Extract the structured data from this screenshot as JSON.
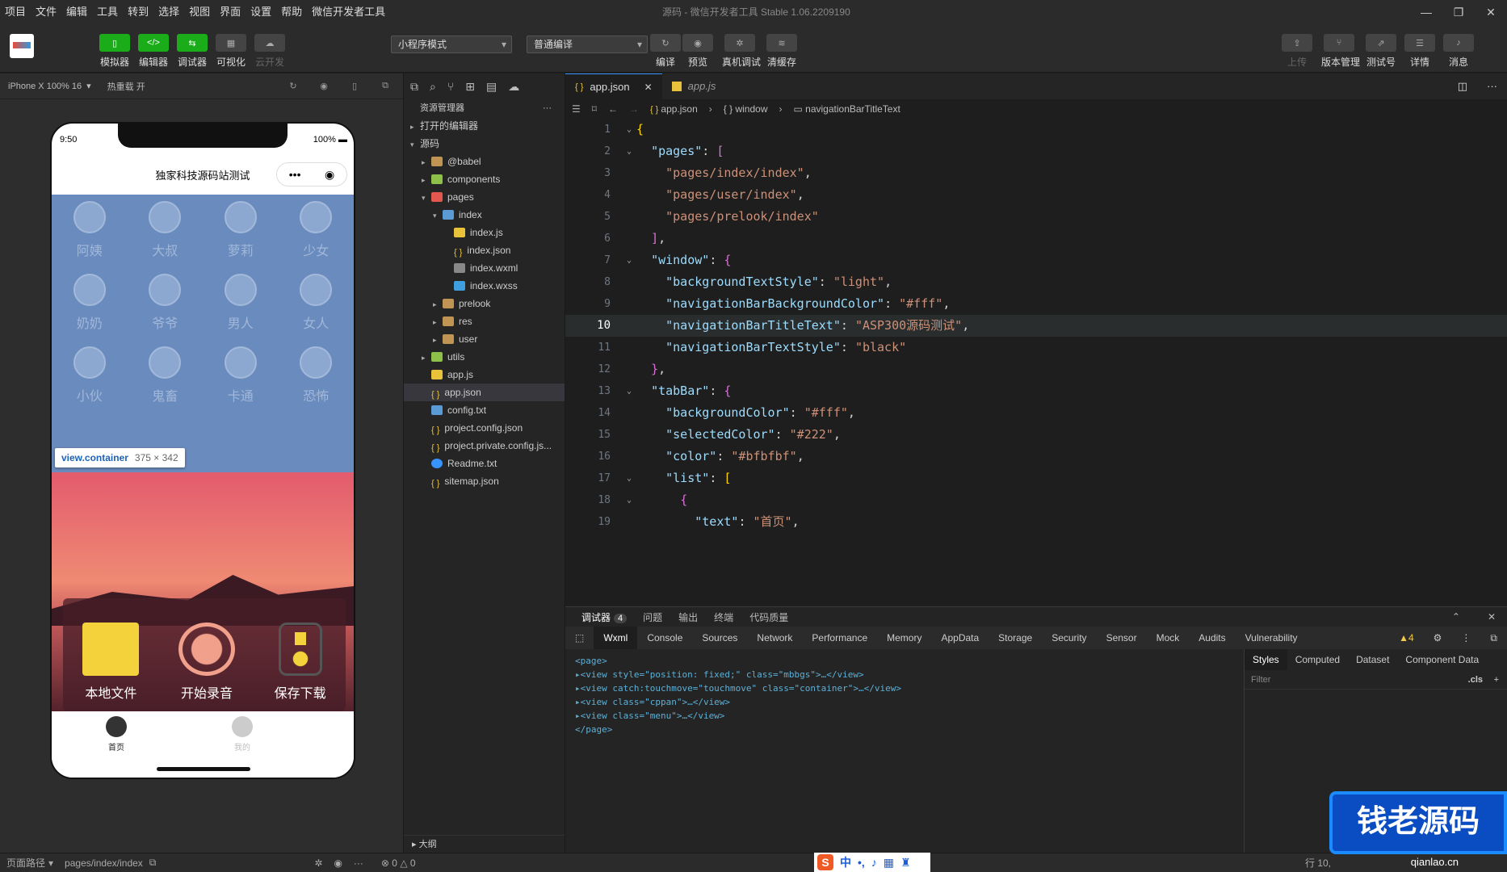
{
  "menu": [
    "项目",
    "文件",
    "编辑",
    "工具",
    "转到",
    "选择",
    "视图",
    "界面",
    "设置",
    "帮助",
    "微信开发者工具"
  ],
  "window_title": "源码 - 微信开发者工具 Stable 1.06.2209190",
  "toolbar": {
    "simulator": "模拟器",
    "editor": "编辑器",
    "debugger": "调试器",
    "visual": "可视化",
    "cloud": "云开发",
    "mode_select": "小程序模式",
    "compile_select": "普通编译",
    "compile": "编译",
    "preview": "预览",
    "real_debug": "真机调试",
    "clear_cache": "清缓存",
    "upload": "上传",
    "version": "版本管理",
    "test_id": "测试号",
    "details": "详情",
    "messages": "消息"
  },
  "simulator": {
    "device": "iPhone X 100% 16",
    "hot_reload": "热重载 开",
    "time": "9:50",
    "battery": "100%",
    "nav_title": "独家科技源码站测试",
    "avatars": [
      "阿姨",
      "大叔",
      "萝莉",
      "少女",
      "奶奶",
      "爷爷",
      "男人",
      "女人",
      "小伙",
      "鬼畜",
      "卡通",
      "恐怖"
    ],
    "tooltip_name": "view.container",
    "tooltip_size": "375 × 342",
    "buttons": [
      "本地文件",
      "开始录音",
      "保存下载"
    ],
    "tabs": [
      "首页",
      "我的"
    ]
  },
  "explorer": {
    "title": "资源管理器",
    "open_editors": "打开的编辑器",
    "root": "源码",
    "outline": "大纲",
    "tree": [
      {
        "name": "@babel",
        "depth": 1,
        "type": "folder",
        "arrow": "▸"
      },
      {
        "name": "components",
        "depth": 1,
        "type": "folder-g",
        "arrow": "▸"
      },
      {
        "name": "pages",
        "depth": 1,
        "type": "folder-r",
        "arrow": "▾"
      },
      {
        "name": "index",
        "depth": 2,
        "type": "folder-b",
        "arrow": "▾"
      },
      {
        "name": "index.js",
        "depth": 3,
        "type": "js",
        "arrow": ""
      },
      {
        "name": "index.json",
        "depth": 3,
        "type": "json",
        "arrow": ""
      },
      {
        "name": "index.wxml",
        "depth": 3,
        "type": "wxml",
        "arrow": ""
      },
      {
        "name": "index.wxss",
        "depth": 3,
        "type": "css",
        "arrow": ""
      },
      {
        "name": "prelook",
        "depth": 2,
        "type": "folder",
        "arrow": "▸"
      },
      {
        "name": "res",
        "depth": 2,
        "type": "folder",
        "arrow": "▸"
      },
      {
        "name": "user",
        "depth": 2,
        "type": "folder",
        "arrow": "▸"
      },
      {
        "name": "utils",
        "depth": 1,
        "type": "folder-g",
        "arrow": "▸"
      },
      {
        "name": "app.js",
        "depth": 1,
        "type": "js",
        "arrow": ""
      },
      {
        "name": "app.json",
        "depth": 1,
        "type": "json",
        "arrow": "",
        "selected": true
      },
      {
        "name": "config.txt",
        "depth": 1,
        "type": "txt",
        "arrow": ""
      },
      {
        "name": "project.config.json",
        "depth": 1,
        "type": "json",
        "arrow": ""
      },
      {
        "name": "project.private.config.js...",
        "depth": 1,
        "type": "json",
        "arrow": ""
      },
      {
        "name": "Readme.txt",
        "depth": 1,
        "type": "info",
        "arrow": ""
      },
      {
        "name": "sitemap.json",
        "depth": 1,
        "type": "json",
        "arrow": ""
      }
    ]
  },
  "editor": {
    "tabs": [
      {
        "label": "app.json",
        "active": true
      },
      {
        "label": "app.js",
        "active": false
      }
    ],
    "breadcrumb": [
      "app.json",
      "window",
      "navigationBarTitleText"
    ],
    "lines": [
      {
        "n": "1",
        "html": "<span class='y'>{</span>",
        "fold": "⌄"
      },
      {
        "n": "2",
        "html": "  <span class='k'>\"pages\"</span>: <span class='p'>[</span>",
        "fold": "⌄"
      },
      {
        "n": "3",
        "html": "    <span class='s'>\"pages/index/index\"</span>,",
        "fold": ""
      },
      {
        "n": "4",
        "html": "    <span class='s'>\"pages/user/index\"</span>,",
        "fold": ""
      },
      {
        "n": "5",
        "html": "    <span class='s'>\"pages/prelook/index\"</span>",
        "fold": ""
      },
      {
        "n": "6",
        "html": "  <span class='p'>]</span>,",
        "fold": ""
      },
      {
        "n": "7",
        "html": "  <span class='k'>\"window\"</span>: <span class='p'>{</span>",
        "fold": "⌄"
      },
      {
        "n": "8",
        "html": "    <span class='k'>\"backgroundTextStyle\"</span>: <span class='s'>\"light\"</span>,",
        "fold": ""
      },
      {
        "n": "9",
        "html": "    <span class='k'>\"navigationBarBackgroundColor\"</span>: <span class='s'>\"#fff\"</span>,",
        "fold": ""
      },
      {
        "n": "10",
        "html": "    <span class='k'>\"navigationBarTitleText\"</span>: <span class='s'>\"ASP300源码测试\"</span>,",
        "fold": "",
        "hl": true
      },
      {
        "n": "11",
        "html": "    <span class='k'>\"navigationBarTextStyle\"</span>: <span class='s'>\"black\"</span>",
        "fold": ""
      },
      {
        "n": "12",
        "html": "  <span class='p'>}</span>,",
        "fold": ""
      },
      {
        "n": "13",
        "html": "  <span class='k'>\"tabBar\"</span>: <span class='p'>{</span>",
        "fold": "⌄"
      },
      {
        "n": "14",
        "html": "    <span class='k'>\"backgroundColor\"</span>: <span class='s'>\"#fff\"</span>,",
        "fold": ""
      },
      {
        "n": "15",
        "html": "    <span class='k'>\"selectedColor\"</span>: <span class='s'>\"#222\"</span>,",
        "fold": ""
      },
      {
        "n": "16",
        "html": "    <span class='k'>\"color\"</span>: <span class='s'>\"#bfbfbf\"</span>,",
        "fold": ""
      },
      {
        "n": "17",
        "html": "    <span class='k'>\"list\"</span>: <span class='y'>[</span>",
        "fold": "⌄"
      },
      {
        "n": "18",
        "html": "      <span class='p'>{</span>",
        "fold": "⌄"
      },
      {
        "n": "19",
        "html": "        <span class='k'>\"text\"</span>: <span class='s'>\"首页\"</span>,",
        "fold": ""
      }
    ]
  },
  "devtools": {
    "top_tabs": [
      "调试器",
      "问题",
      "输出",
      "终端",
      "代码质量"
    ],
    "badge": "4",
    "tabs": [
      "Wxml",
      "Console",
      "Sources",
      "Network",
      "Performance",
      "Memory",
      "AppData",
      "Storage",
      "Security",
      "Sensor",
      "Mock",
      "Audits",
      "Vulnerability"
    ],
    "warnings": "▲4",
    "wxml_lines": [
      "<page>",
      "▸<view style=\"position: fixed;\" class=\"mbbgs\">…</view>",
      "▸<view catch:touchmove=\"touchmove\" class=\"container\">…</view>",
      "▸<view class=\"cppan\">…</view>",
      "▸<view class=\"menu\">…</view>",
      "</page>"
    ],
    "style_tabs": [
      "Styles",
      "Computed",
      "Dataset",
      "Component Data"
    ],
    "filter_placeholder": "Filter",
    "cls": ".cls"
  },
  "statusbar": {
    "path_label": "页面路径",
    "path": "pages/index/index",
    "errors": "⊗ 0 △ 0",
    "position": "行 10,"
  },
  "watermark": {
    "text": "钱老源码",
    "site": "qianlao.cn"
  }
}
